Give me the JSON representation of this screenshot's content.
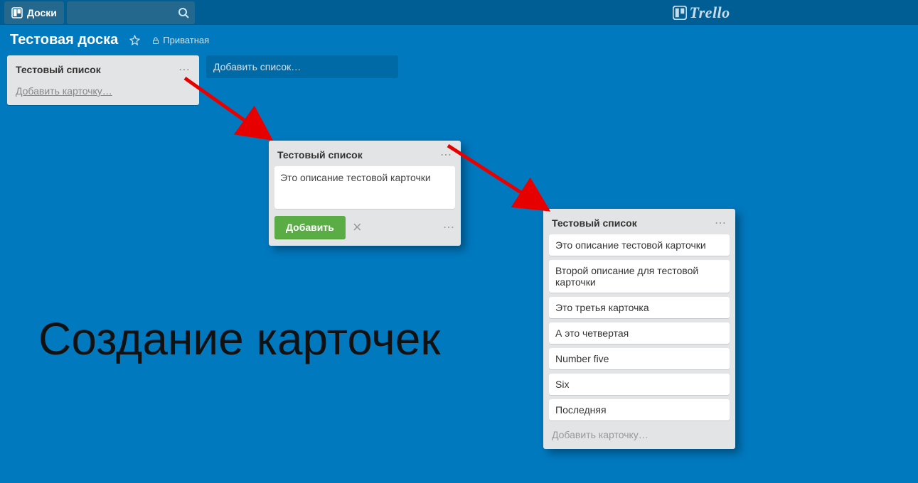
{
  "header": {
    "boards_button": "Доски",
    "logo_text": "Trello"
  },
  "board": {
    "name": "Тестовая доска",
    "privacy_label": "Приватная"
  },
  "step1": {
    "list_title": "Тестовый список",
    "add_card": "Добавить карточку…",
    "add_list": "Добавить список…"
  },
  "step2": {
    "list_title": "Тестовый список",
    "composer_text": "Это описание тестовой карточки",
    "add_button": "Добавить"
  },
  "step3": {
    "list_title": "Тестовый список",
    "cards": [
      "Это описание тестовой карточки",
      "Второй описание для тестовой карточки",
      "Это третья карточка",
      "А это четвертая",
      "Number five",
      "Six",
      "Последняя"
    ],
    "add_card": "Добавить карточку…"
  },
  "caption": "Создание карточек"
}
